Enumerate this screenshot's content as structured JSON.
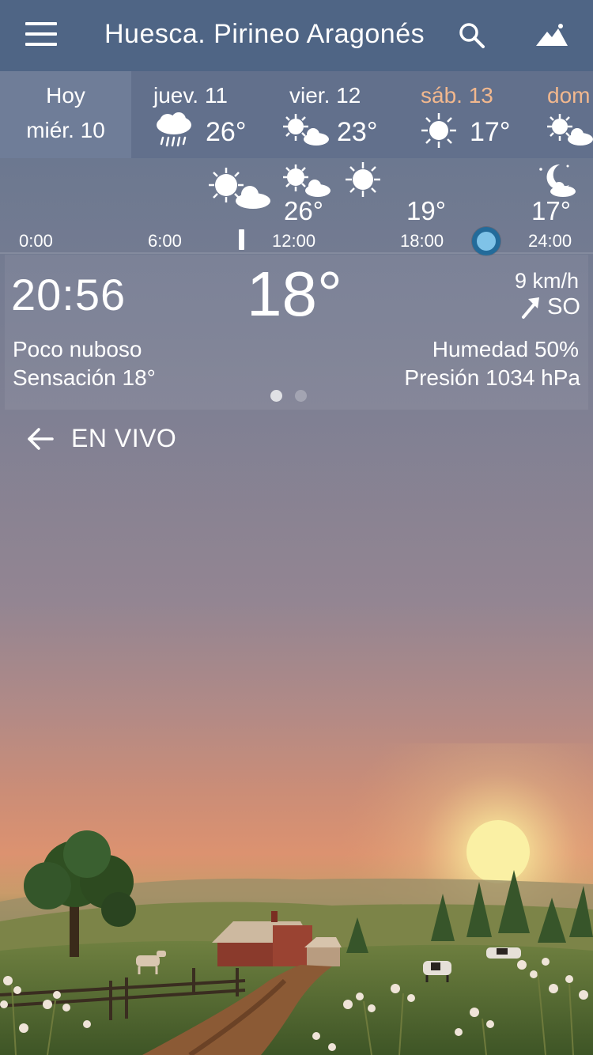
{
  "header": {
    "location": "Huesca. Pirineo Aragonés"
  },
  "days": {
    "today": {
      "line1": "Hoy",
      "line2": "miér. 10"
    },
    "items": [
      {
        "name": "juev. 11",
        "temp": "26°",
        "icon": "rain-cloud-icon"
      },
      {
        "name": "vier. 12",
        "temp": "23°",
        "icon": "sun-cloud-icon"
      },
      {
        "name": "sáb. 13",
        "temp": "17°",
        "icon": "sun-icon"
      },
      {
        "name": "dom",
        "temp": "",
        "icon": "sun-cloud-icon"
      }
    ]
  },
  "hourly": {
    "temps": [
      "26°",
      "19°",
      "17°"
    ],
    "labels": [
      "0:00",
      "6:00",
      "12:00",
      "18:00",
      "24:00"
    ]
  },
  "current": {
    "time": "20:56",
    "temperature": "18°",
    "wind_speed": "9 km/h",
    "wind_direction": "SO",
    "condition": "Poco nuboso",
    "feels_like": "Sensación 18°",
    "humidity": "Humedad 50%",
    "pressure": "Presión 1034 hPa"
  },
  "live": {
    "label": "EN VIVO"
  },
  "colors": {
    "topbar": "#4f6585",
    "weekend": "#f2b88e",
    "slider": "#236b9a"
  }
}
